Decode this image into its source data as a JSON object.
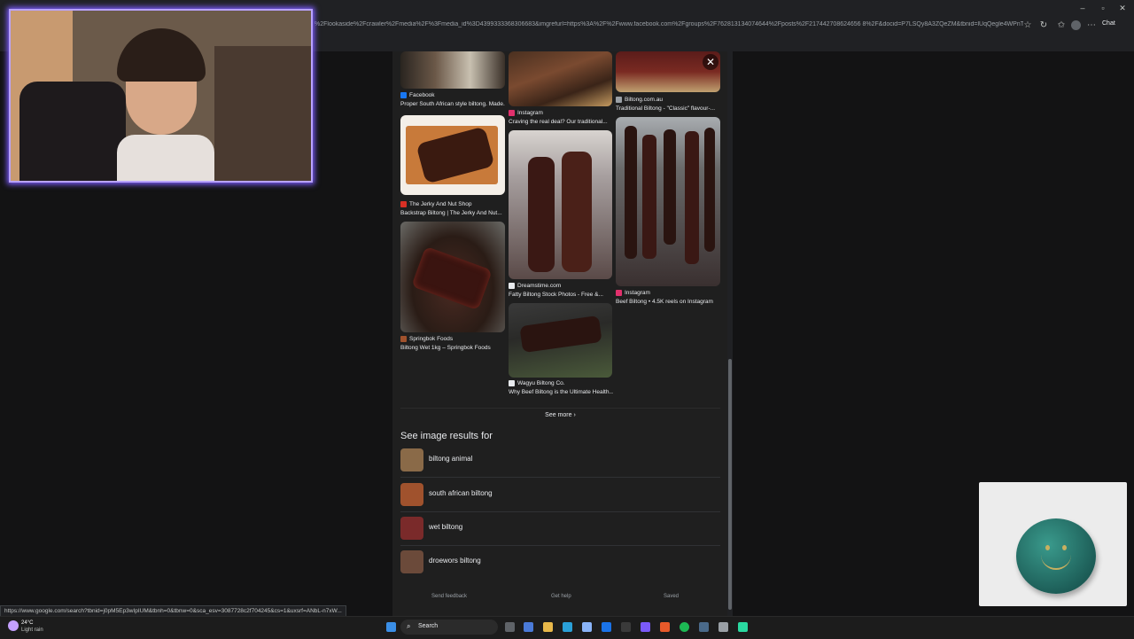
{
  "browser": {
    "url": "%2Flookaside%2Fcrawler%2Fmedia%2F%3Fmedia_id%3D4399333368306683&imgrefurl=https%3A%2F%2Fwww.facebook.com%2Fgroups%2F762813134074644%2Fposts%2F217442708624656 8%2F&docid=P7LSQy8A3ZQeZM&tbnid=lUqQegle4WPnTM&v...",
    "chat_label": "Chat",
    "status_url": "https://www.google.com/search?tbnid=j0pM5Ep3wIpIUM&tbnh=0&tbnw=0&sca_esv=3087728c2f704245&cs=1&uxsrf=ANbL-n7xW..."
  },
  "results": [
    {
      "source": "Facebook",
      "caption": "Proper South African style biltong. Made...",
      "fav_color": "#1877f2"
    },
    {
      "source": "Instagram",
      "caption": "Craving the real deal? Our traditional...",
      "fav_color": "#e1306c"
    },
    {
      "source": "Biltong.com.au",
      "caption": "Traditional Biltong - \"Classic\" flavour-...",
      "fav_color": "#9aa0a6"
    },
    {
      "source": "The Jerky And Nut Shop",
      "caption": "Backstrap Biltong | The Jerky And Nut...",
      "fav_color": "#d93025"
    },
    {
      "source": "Dreamstime.com",
      "caption": "Fatty Biltong Stock Photos - Free &...",
      "fav_color": "#e8eaed"
    },
    {
      "source": "Instagram",
      "caption": "Beef Biltong • 4.5K reels on Instagram",
      "fav_color": "#e1306c"
    },
    {
      "source": "Springbok Foods",
      "caption": "Biltong Wet 1kg – Springbok Foods",
      "fav_color": "#a0522d"
    },
    {
      "source": "Wagyu Biltong Co.",
      "caption": "Why Beef Biltong is the Ultimate Health...",
      "fav_color": "#e8eaed"
    }
  ],
  "see_more": "See more",
  "see_image_results_title": "See image results for",
  "related": [
    {
      "label": "biltong animal",
      "thumb_color": "#8a6a48"
    },
    {
      "label": "south african biltong",
      "thumb_color": "#a0522d"
    },
    {
      "label": "wet biltong",
      "thumb_color": "#7a2a2a"
    },
    {
      "label": "droewors biltong",
      "thumb_color": "#6b4a3a"
    }
  ],
  "footer": {
    "feedback": "Send feedback",
    "help": "Get help",
    "saved": "Saved"
  },
  "taskbar": {
    "weather_temp": "24°C",
    "weather_desc": "Light rain",
    "search": "Search"
  }
}
